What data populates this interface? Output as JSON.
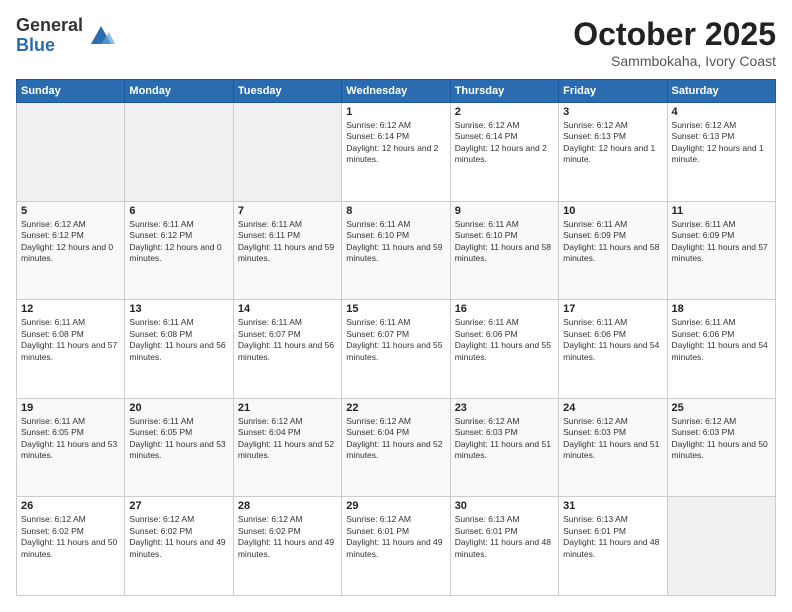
{
  "logo": {
    "general": "General",
    "blue": "Blue"
  },
  "header": {
    "month": "October 2025",
    "location": "Sammbokaha, Ivory Coast"
  },
  "weekdays": [
    "Sunday",
    "Monday",
    "Tuesday",
    "Wednesday",
    "Thursday",
    "Friday",
    "Saturday"
  ],
  "weeks": [
    [
      {
        "day": "",
        "sunrise": "",
        "sunset": "",
        "daylight": ""
      },
      {
        "day": "",
        "sunrise": "",
        "sunset": "",
        "daylight": ""
      },
      {
        "day": "",
        "sunrise": "",
        "sunset": "",
        "daylight": ""
      },
      {
        "day": "1",
        "sunrise": "Sunrise: 6:12 AM",
        "sunset": "Sunset: 6:14 PM",
        "daylight": "Daylight: 12 hours and 2 minutes."
      },
      {
        "day": "2",
        "sunrise": "Sunrise: 6:12 AM",
        "sunset": "Sunset: 6:14 PM",
        "daylight": "Daylight: 12 hours and 2 minutes."
      },
      {
        "day": "3",
        "sunrise": "Sunrise: 6:12 AM",
        "sunset": "Sunset: 6:13 PM",
        "daylight": "Daylight: 12 hours and 1 minute."
      },
      {
        "day": "4",
        "sunrise": "Sunrise: 6:12 AM",
        "sunset": "Sunset: 6:13 PM",
        "daylight": "Daylight: 12 hours and 1 minute."
      }
    ],
    [
      {
        "day": "5",
        "sunrise": "Sunrise: 6:12 AM",
        "sunset": "Sunset: 6:12 PM",
        "daylight": "Daylight: 12 hours and 0 minutes."
      },
      {
        "day": "6",
        "sunrise": "Sunrise: 6:11 AM",
        "sunset": "Sunset: 6:12 PM",
        "daylight": "Daylight: 12 hours and 0 minutes."
      },
      {
        "day": "7",
        "sunrise": "Sunrise: 6:11 AM",
        "sunset": "Sunset: 6:11 PM",
        "daylight": "Daylight: 11 hours and 59 minutes."
      },
      {
        "day": "8",
        "sunrise": "Sunrise: 6:11 AM",
        "sunset": "Sunset: 6:10 PM",
        "daylight": "Daylight: 11 hours and 59 minutes."
      },
      {
        "day": "9",
        "sunrise": "Sunrise: 6:11 AM",
        "sunset": "Sunset: 6:10 PM",
        "daylight": "Daylight: 11 hours and 58 minutes."
      },
      {
        "day": "10",
        "sunrise": "Sunrise: 6:11 AM",
        "sunset": "Sunset: 6:09 PM",
        "daylight": "Daylight: 11 hours and 58 minutes."
      },
      {
        "day": "11",
        "sunrise": "Sunrise: 6:11 AM",
        "sunset": "Sunset: 6:09 PM",
        "daylight": "Daylight: 11 hours and 57 minutes."
      }
    ],
    [
      {
        "day": "12",
        "sunrise": "Sunrise: 6:11 AM",
        "sunset": "Sunset: 6:08 PM",
        "daylight": "Daylight: 11 hours and 57 minutes."
      },
      {
        "day": "13",
        "sunrise": "Sunrise: 6:11 AM",
        "sunset": "Sunset: 6:08 PM",
        "daylight": "Daylight: 11 hours and 56 minutes."
      },
      {
        "day": "14",
        "sunrise": "Sunrise: 6:11 AM",
        "sunset": "Sunset: 6:07 PM",
        "daylight": "Daylight: 11 hours and 56 minutes."
      },
      {
        "day": "15",
        "sunrise": "Sunrise: 6:11 AM",
        "sunset": "Sunset: 6:07 PM",
        "daylight": "Daylight: 11 hours and 55 minutes."
      },
      {
        "day": "16",
        "sunrise": "Sunrise: 6:11 AM",
        "sunset": "Sunset: 6:06 PM",
        "daylight": "Daylight: 11 hours and 55 minutes."
      },
      {
        "day": "17",
        "sunrise": "Sunrise: 6:11 AM",
        "sunset": "Sunset: 6:06 PM",
        "daylight": "Daylight: 11 hours and 54 minutes."
      },
      {
        "day": "18",
        "sunrise": "Sunrise: 6:11 AM",
        "sunset": "Sunset: 6:06 PM",
        "daylight": "Daylight: 11 hours and 54 minutes."
      }
    ],
    [
      {
        "day": "19",
        "sunrise": "Sunrise: 6:11 AM",
        "sunset": "Sunset: 6:05 PM",
        "daylight": "Daylight: 11 hours and 53 minutes."
      },
      {
        "day": "20",
        "sunrise": "Sunrise: 6:11 AM",
        "sunset": "Sunset: 6:05 PM",
        "daylight": "Daylight: 11 hours and 53 minutes."
      },
      {
        "day": "21",
        "sunrise": "Sunrise: 6:12 AM",
        "sunset": "Sunset: 6:04 PM",
        "daylight": "Daylight: 11 hours and 52 minutes."
      },
      {
        "day": "22",
        "sunrise": "Sunrise: 6:12 AM",
        "sunset": "Sunset: 6:04 PM",
        "daylight": "Daylight: 11 hours and 52 minutes."
      },
      {
        "day": "23",
        "sunrise": "Sunrise: 6:12 AM",
        "sunset": "Sunset: 6:03 PM",
        "daylight": "Daylight: 11 hours and 51 minutes."
      },
      {
        "day": "24",
        "sunrise": "Sunrise: 6:12 AM",
        "sunset": "Sunset: 6:03 PM",
        "daylight": "Daylight: 11 hours and 51 minutes."
      },
      {
        "day": "25",
        "sunrise": "Sunrise: 6:12 AM",
        "sunset": "Sunset: 6:03 PM",
        "daylight": "Daylight: 11 hours and 50 minutes."
      }
    ],
    [
      {
        "day": "26",
        "sunrise": "Sunrise: 6:12 AM",
        "sunset": "Sunset: 6:02 PM",
        "daylight": "Daylight: 11 hours and 50 minutes."
      },
      {
        "day": "27",
        "sunrise": "Sunrise: 6:12 AM",
        "sunset": "Sunset: 6:02 PM",
        "daylight": "Daylight: 11 hours and 49 minutes."
      },
      {
        "day": "28",
        "sunrise": "Sunrise: 6:12 AM",
        "sunset": "Sunset: 6:02 PM",
        "daylight": "Daylight: 11 hours and 49 minutes."
      },
      {
        "day": "29",
        "sunrise": "Sunrise: 6:12 AM",
        "sunset": "Sunset: 6:01 PM",
        "daylight": "Daylight: 11 hours and 49 minutes."
      },
      {
        "day": "30",
        "sunrise": "Sunrise: 6:13 AM",
        "sunset": "Sunset: 6:01 PM",
        "daylight": "Daylight: 11 hours and 48 minutes."
      },
      {
        "day": "31",
        "sunrise": "Sunrise: 6:13 AM",
        "sunset": "Sunset: 6:01 PM",
        "daylight": "Daylight: 11 hours and 48 minutes."
      },
      {
        "day": "",
        "sunrise": "",
        "sunset": "",
        "daylight": ""
      }
    ]
  ]
}
